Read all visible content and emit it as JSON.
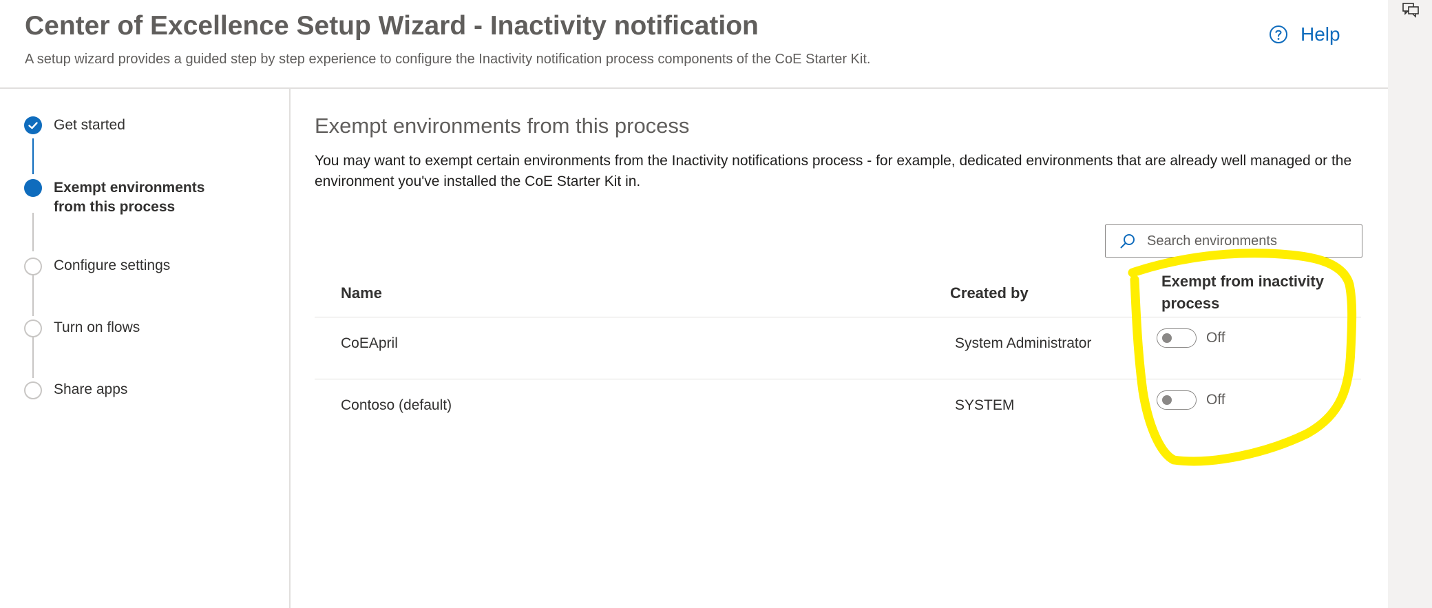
{
  "header": {
    "title": "Center of Excellence Setup Wizard - Inactivity notification",
    "subtitle": "A setup wizard provides a guided step by step experience to configure the Inactivity notification process components of the CoE Starter Kit.",
    "help_label": "Help"
  },
  "steps": [
    {
      "label": "Get started",
      "status": "completed"
    },
    {
      "label": "Exempt environments from this process",
      "status": "current"
    },
    {
      "label": "Configure settings",
      "status": "pending"
    },
    {
      "label": "Turn on flows",
      "status": "pending"
    },
    {
      "label": "Share apps",
      "status": "pending"
    }
  ],
  "main": {
    "section_title": "Exempt environments from this process",
    "description": "You may want to exempt certain environments from the Inactivity notifications process - for example, dedicated environments that are already well managed or the environment you've installed the CoE Starter Kit in.",
    "search_placeholder": "Search environments"
  },
  "table": {
    "columns": [
      "Name",
      "Created by",
      "Exempt from inactivity process"
    ],
    "rows": [
      {
        "name": "CoEApril",
        "created_by": "System Administrator",
        "exempt": false,
        "toggle_label": "Off"
      },
      {
        "name": "Contoso (default)",
        "created_by": "SYSTEM",
        "exempt": false,
        "toggle_label": "Off"
      }
    ]
  },
  "colors": {
    "accent": "#0f6cbd",
    "highlight": "#ffee00"
  },
  "icons": {
    "help": "help-circle-icon",
    "search": "search-icon",
    "check": "checkmark-icon",
    "feedback": "feedback-icon"
  }
}
